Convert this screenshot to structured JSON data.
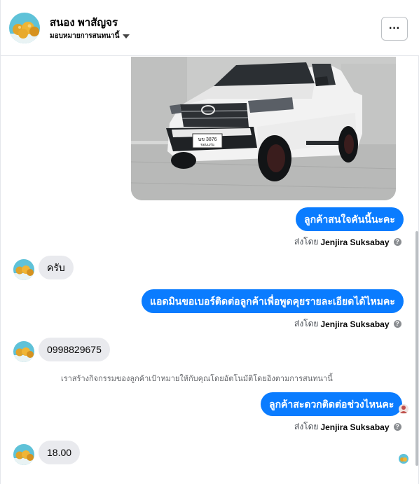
{
  "header": {
    "contact_name": "สนอง พาสัญจร",
    "assign_label": "มอบหมายการสนทนานี้",
    "more_label": "···"
  },
  "messages": [
    {
      "type": "outgoing",
      "text": "ลูกค้าสนใจคันนี้นะคะ",
      "sent_by_prefix": "ส่งโดย",
      "sent_by_name": "Jenjira Suksabay"
    },
    {
      "type": "incoming",
      "text": "ครับ"
    },
    {
      "type": "outgoing",
      "text": "แอดมินขอเบอร์ติดต่อลูกค้าเพื่อพูดคุยรายละเอียดได้ไหมคะ",
      "sent_by_prefix": "ส่งโดย",
      "sent_by_name": "Jenjira Suksabay"
    },
    {
      "type": "incoming",
      "text": "0998829675"
    },
    {
      "type": "system",
      "text": "เราสร้างกิจกรรมของลูกค้าเป้าหมายให้กับคุณโดยอัตโนมัติโดยอิงตามการสนทนานี้"
    },
    {
      "type": "outgoing",
      "text": "ลูกค้าสะดวกติดต่อช่วงไหนคะ",
      "sent_by_prefix": "ส่งโดย",
      "sent_by_name": "Jenjira Suksabay"
    },
    {
      "type": "incoming",
      "text": "18.00"
    }
  ],
  "photo": {
    "plate_line1": "นข 3876",
    "plate_line2": "ขอนแก่น",
    "icon": "pickup-truck-photo"
  },
  "colors": {
    "accent": "#0a7cff",
    "incoming_bubble": "#e9eaee",
    "muted_text": "#65676b"
  }
}
